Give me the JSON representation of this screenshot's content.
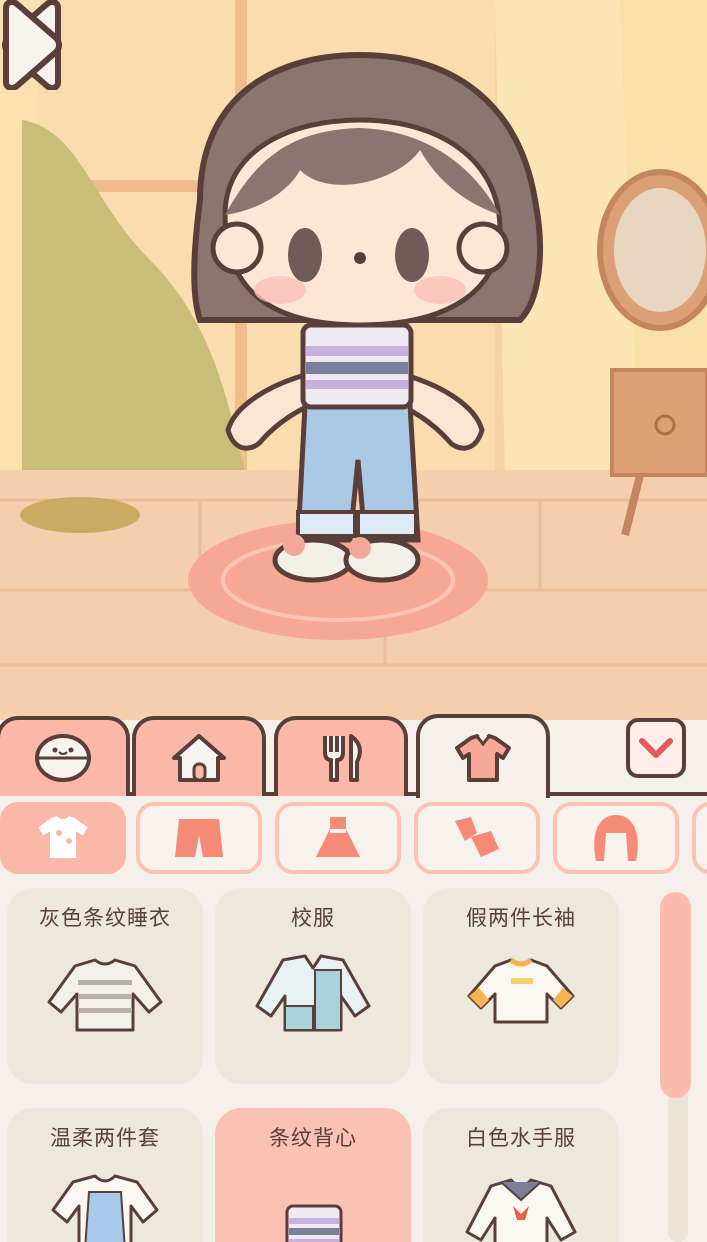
{
  "navigation": {
    "prev_icon": "triangle-left-icon",
    "next_icon": "triangle-right-icon"
  },
  "main_tabs": [
    {
      "icon": "face-icon",
      "active": false
    },
    {
      "icon": "house-icon",
      "active": false
    },
    {
      "icon": "fork-knife-icon",
      "active": false
    },
    {
      "icon": "shirt-icon",
      "active": true
    }
  ],
  "collapse_icon": "chevron-down-icon",
  "sub_categories": [
    {
      "icon": "tshirt-icon",
      "active": true
    },
    {
      "icon": "shorts-icon",
      "active": false
    },
    {
      "icon": "dress-icon",
      "active": false
    },
    {
      "icon": "shoes-icon",
      "active": false
    },
    {
      "icon": "hair-icon",
      "active": false
    }
  ],
  "items": [
    {
      "label": "灰色条纹睡衣",
      "icon": "striped-pajama-icon",
      "selected": false
    },
    {
      "label": "校服",
      "icon": "school-uniform-icon",
      "selected": false
    },
    {
      "label": "假两件长袖",
      "icon": "long-sleeve-icon",
      "selected": false
    },
    {
      "label": "温柔两件套",
      "icon": "two-piece-icon",
      "selected": false
    },
    {
      "label": "条纹背心",
      "icon": "striped-vest-icon",
      "selected": true
    },
    {
      "label": "白色水手服",
      "icon": "sailor-uniform-icon",
      "selected": false
    }
  ],
  "colors": {
    "outline": "#5a3e3a",
    "accent_pink": "#fbb8a8",
    "panel_bg": "#f5f1ea",
    "card_bg": "#ede7dc"
  }
}
